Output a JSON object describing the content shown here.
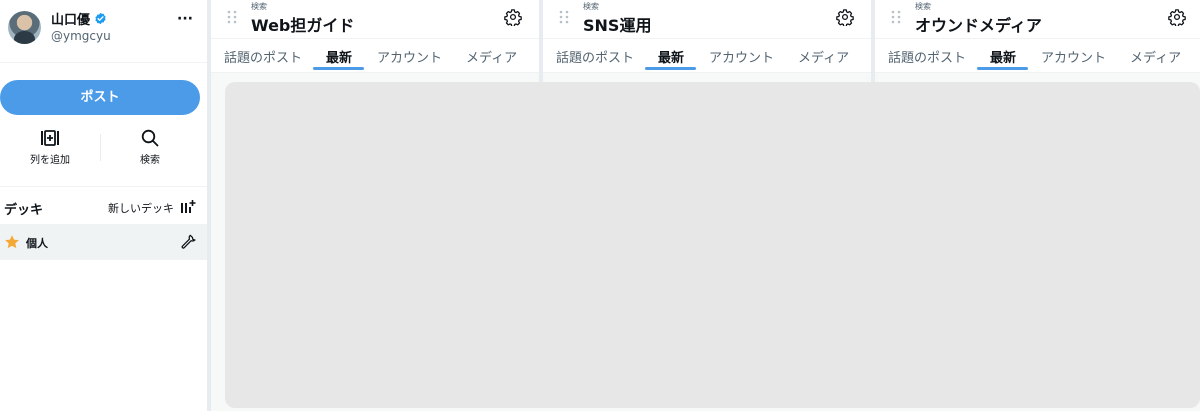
{
  "profile": {
    "name": "山口優",
    "handle": "@ymgcyu",
    "more": "···"
  },
  "sidebar": {
    "post_button": "ポスト",
    "actions": [
      {
        "label": "列を追加",
        "icon": "add-column-icon"
      },
      {
        "label": "検索",
        "icon": "search-icon"
      }
    ],
    "deck": {
      "title": "デッキ",
      "new_deck": "新しいデッキ",
      "items": [
        {
          "label": "個人",
          "icon": "star-icon"
        }
      ]
    }
  },
  "columns": [
    {
      "subtitle": "検索",
      "title": "Web担ガイド",
      "tabs": [
        "話題のポスト",
        "最新",
        "アカウント",
        "メディア"
      ],
      "active_tab": 1
    },
    {
      "subtitle": "検索",
      "title": "SNS運用",
      "tabs": [
        "話題のポスト",
        "最新",
        "アカウント",
        "メディア"
      ],
      "active_tab": 1
    },
    {
      "subtitle": "検索",
      "title": "オウンドメディア",
      "tabs": [
        "話題のポスト",
        "最新",
        "アカウント",
        "メディア"
      ],
      "active_tab": 1
    }
  ],
  "colors": {
    "accent": "#4c9be8",
    "verified": "#1d9bf0",
    "star": "#f4a937",
    "loading_overlay": "#e7e7e7"
  }
}
